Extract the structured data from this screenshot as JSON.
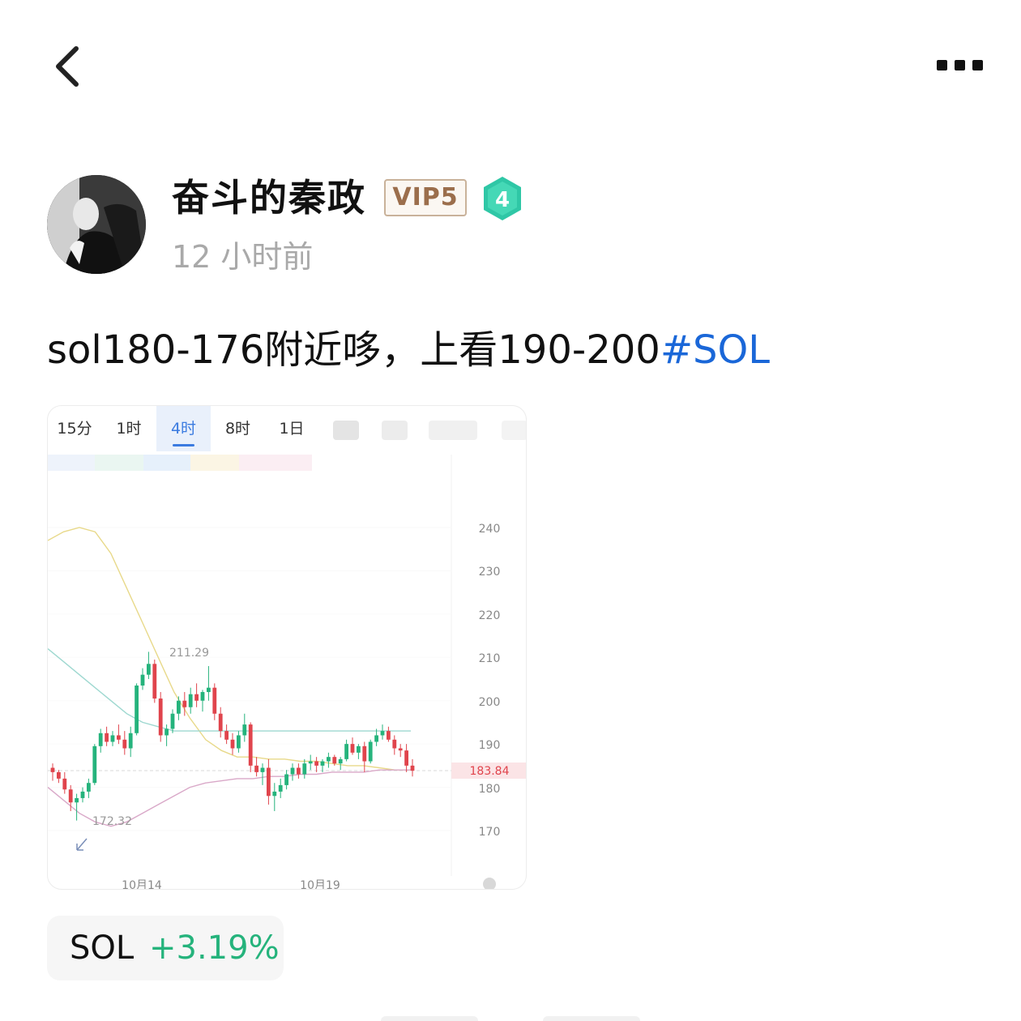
{
  "nav": {
    "back_icon": "chevron-left-icon",
    "more_icon": "more-horizontal-icon"
  },
  "author": {
    "name": "奋斗的秦政",
    "vip": "VIP5",
    "level": "4",
    "posted": "12 小时前",
    "avatar_icon": "user-avatar"
  },
  "post": {
    "text": "sol180-176附近哆，上看190-200",
    "hashtag": "#SOL"
  },
  "chart_tabs": [
    {
      "label": "15分",
      "active": false
    },
    {
      "label": "1时",
      "active": false
    },
    {
      "label": "4时",
      "active": true
    },
    {
      "label": "8时",
      "active": false
    },
    {
      "label": "1日",
      "active": false
    }
  ],
  "chart_data": {
    "type": "candlestick",
    "y_ticks": [
      240,
      230,
      220,
      210,
      200,
      190,
      180,
      170
    ],
    "ylim": [
      164,
      246
    ],
    "x_ticks": [
      "10月14",
      "10月19"
    ],
    "last_price": "183.84",
    "high_label": "211.29",
    "low_label": "172.32",
    "candles": [
      [
        184.5,
        185.5,
        181.5,
        183.5
      ],
      [
        183.5,
        184,
        181,
        182
      ],
      [
        182,
        183.5,
        178.5,
        179.5
      ],
      [
        179.5,
        180.5,
        174.5,
        176.5
      ],
      [
        176.5,
        178.5,
        172.32,
        177.5
      ],
      [
        177.5,
        180,
        176.5,
        179
      ],
      [
        179,
        182,
        177.5,
        181
      ],
      [
        181,
        190,
        180.5,
        189.5
      ],
      [
        189.5,
        193.5,
        188,
        192.5
      ],
      [
        192.5,
        194,
        189.5,
        190.5
      ],
      [
        190.5,
        193,
        189.5,
        192
      ],
      [
        192,
        194.5,
        190,
        191
      ],
      [
        191,
        193,
        187.5,
        189
      ],
      [
        189,
        194,
        187,
        192.5
      ],
      [
        192.5,
        204,
        192,
        203.5
      ],
      [
        203.5,
        207.5,
        202.5,
        206
      ],
      [
        206,
        211.29,
        205,
        208.5
      ],
      [
        208.5,
        209.5,
        199.5,
        200.5
      ],
      [
        200.5,
        202,
        190.5,
        192
      ],
      [
        192,
        194.5,
        189.5,
        193.5
      ],
      [
        193.5,
        198,
        192.5,
        197
      ],
      [
        197,
        201,
        195.5,
        200
      ],
      [
        200,
        202,
        196.5,
        198.5
      ],
      [
        198.5,
        203,
        197,
        201.5
      ],
      [
        201.5,
        204,
        198.5,
        200
      ],
      [
        200,
        202.5,
        197.5,
        202
      ],
      [
        202,
        208,
        200,
        203
      ],
      [
        203,
        204,
        195.5,
        197
      ],
      [
        197,
        198.5,
        191.5,
        193
      ],
      [
        193,
        194.5,
        190,
        191
      ],
      [
        191,
        192.5,
        187.5,
        189
      ],
      [
        189,
        193,
        188,
        192
      ],
      [
        192,
        197,
        190.5,
        194.5
      ],
      [
        194.5,
        195,
        183.5,
        185
      ],
      [
        185,
        187,
        182.5,
        183.5
      ],
      [
        183.5,
        185.5,
        180.5,
        184.5
      ],
      [
        184.5,
        186.5,
        176,
        178
      ],
      [
        178,
        181,
        174.5,
        179
      ],
      [
        179,
        182,
        177.5,
        180.5
      ],
      [
        180.5,
        184,
        179.5,
        183
      ],
      [
        183,
        185.5,
        181.5,
        184.5
      ],
      [
        184.5,
        185.5,
        182,
        183
      ],
      [
        183,
        186.5,
        182,
        185.5
      ],
      [
        185.5,
        187.5,
        184,
        186
      ],
      [
        186,
        187,
        183.5,
        185
      ],
      [
        185,
        186.5,
        183.5,
        186
      ],
      [
        186,
        188,
        184.5,
        187
      ],
      [
        187,
        187.5,
        185,
        185.5
      ],
      [
        185.5,
        187,
        184,
        186.5
      ],
      [
        186.5,
        191,
        186,
        190
      ],
      [
        190,
        191.5,
        187.5,
        188
      ],
      [
        188,
        190,
        186.5,
        189.5
      ],
      [
        189.5,
        190.5,
        183.5,
        186
      ],
      [
        186,
        191,
        185.5,
        190.5
      ],
      [
        190.5,
        193.5,
        189.5,
        192
      ],
      [
        192,
        194.5,
        191,
        193
      ],
      [
        193,
        194,
        190.5,
        191
      ],
      [
        191,
        192,
        187.5,
        189
      ],
      [
        189,
        190,
        187,
        188.5
      ],
      [
        188.5,
        190,
        183.5,
        185
      ],
      [
        185,
        186.5,
        182.5,
        183.84
      ]
    ],
    "bands": {
      "upper": [
        237,
        239,
        240,
        239,
        234,
        226,
        218,
        210,
        202,
        196,
        191,
        188.5,
        187,
        187,
        186.5,
        186.5,
        186,
        186,
        185.5,
        185,
        185,
        184.5,
        184,
        184
      ],
      "middle": [
        212,
        209,
        206,
        203,
        200,
        197,
        195,
        194,
        193,
        193,
        193,
        193,
        193,
        193,
        193,
        193,
        193,
        193,
        193,
        193,
        193,
        193,
        193,
        193
      ],
      "lower": [
        180,
        177,
        174,
        172,
        171,
        172,
        174,
        176,
        178,
        180,
        181,
        181.5,
        182,
        182,
        182.5,
        182.5,
        183,
        183,
        183.5,
        183.5,
        183.5,
        184,
        184,
        184
      ]
    }
  },
  "ticker": {
    "symbol": "SOL",
    "change": "+3.19%"
  },
  "colors": {
    "up": "#25b37c",
    "down": "#e0444c",
    "hashtag": "#1a67d8",
    "vip_text": "#9b6e4c",
    "level_badge": "#2fc7a6"
  }
}
